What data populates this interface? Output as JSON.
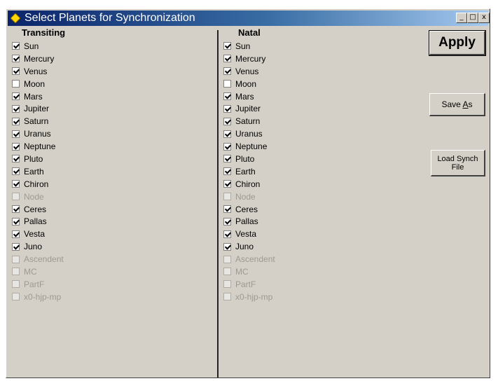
{
  "window": {
    "title": "Select Planets for Synchronization",
    "controls": {
      "minimize": "_",
      "maximize": "□",
      "close": "x"
    }
  },
  "transiting": {
    "header": "Transiting",
    "items": [
      {
        "label": "Sun",
        "checked": true,
        "enabled": true
      },
      {
        "label": "Mercury",
        "checked": true,
        "enabled": true
      },
      {
        "label": "Venus",
        "checked": true,
        "enabled": true
      },
      {
        "label": "Moon",
        "checked": false,
        "enabled": true
      },
      {
        "label": "Mars",
        "checked": true,
        "enabled": true
      },
      {
        "label": "Jupiter",
        "checked": true,
        "enabled": true
      },
      {
        "label": "Saturn",
        "checked": true,
        "enabled": true
      },
      {
        "label": "Uranus",
        "checked": true,
        "enabled": true
      },
      {
        "label": "Neptune",
        "checked": true,
        "enabled": true
      },
      {
        "label": "Pluto",
        "checked": true,
        "enabled": true
      },
      {
        "label": "Earth",
        "checked": true,
        "enabled": true
      },
      {
        "label": "Chiron",
        "checked": true,
        "enabled": true
      },
      {
        "label": "Node",
        "checked": false,
        "enabled": false
      },
      {
        "label": "Ceres",
        "checked": true,
        "enabled": true
      },
      {
        "label": "Pallas",
        "checked": true,
        "enabled": true
      },
      {
        "label": "Vesta",
        "checked": true,
        "enabled": true
      },
      {
        "label": "Juno",
        "checked": true,
        "enabled": true
      },
      {
        "label": "Ascendent",
        "checked": false,
        "enabled": false
      },
      {
        "label": "MC",
        "checked": false,
        "enabled": false
      },
      {
        "label": "PartF",
        "checked": false,
        "enabled": false
      },
      {
        "label": "x0-hjp-mp",
        "checked": false,
        "enabled": false
      }
    ]
  },
  "natal": {
    "header": "Natal",
    "items": [
      {
        "label": "Sun",
        "checked": true,
        "enabled": true
      },
      {
        "label": "Mercury",
        "checked": true,
        "enabled": true
      },
      {
        "label": "Venus",
        "checked": true,
        "enabled": true
      },
      {
        "label": "Moon",
        "checked": false,
        "enabled": true
      },
      {
        "label": "Mars",
        "checked": true,
        "enabled": true
      },
      {
        "label": "Jupiter",
        "checked": true,
        "enabled": true
      },
      {
        "label": "Saturn",
        "checked": true,
        "enabled": true
      },
      {
        "label": "Uranus",
        "checked": true,
        "enabled": true
      },
      {
        "label": "Neptune",
        "checked": true,
        "enabled": true
      },
      {
        "label": "Pluto",
        "checked": true,
        "enabled": true
      },
      {
        "label": "Earth",
        "checked": true,
        "enabled": true
      },
      {
        "label": "Chiron",
        "checked": true,
        "enabled": true
      },
      {
        "label": "Node",
        "checked": false,
        "enabled": false
      },
      {
        "label": "Ceres",
        "checked": true,
        "enabled": true
      },
      {
        "label": "Pallas",
        "checked": true,
        "enabled": true
      },
      {
        "label": "Vesta",
        "checked": true,
        "enabled": true
      },
      {
        "label": "Juno",
        "checked": true,
        "enabled": true
      },
      {
        "label": "Ascendent",
        "checked": false,
        "enabled": false
      },
      {
        "label": "MC",
        "checked": false,
        "enabled": false
      },
      {
        "label": "PartF",
        "checked": false,
        "enabled": false
      },
      {
        "label": "x0-hjp-mp",
        "checked": false,
        "enabled": false
      }
    ]
  },
  "buttons": {
    "apply": "Apply",
    "save_as_prefix": "Save ",
    "save_as_accel": "A",
    "save_as_suffix": "s",
    "load": "Load Synch\nFile"
  },
  "colors": {
    "titlebar_start": "#0a246a",
    "titlebar_end": "#a6caf0",
    "dialog_face": "#d4d0c8",
    "disabled_text": "#9e9a92",
    "title_icon": "#ffd700"
  },
  "icons": {
    "title": "diamond-icon"
  }
}
